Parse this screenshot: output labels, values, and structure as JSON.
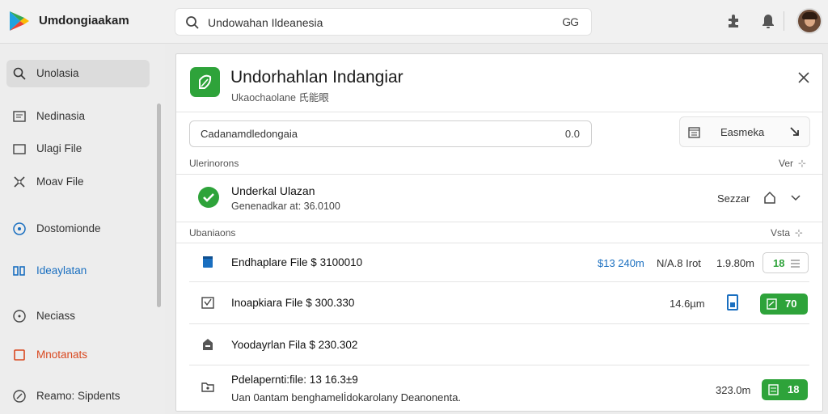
{
  "app": {
    "title": "Umdongiaakam"
  },
  "search": {
    "query": "Undowahan Ildeanesia",
    "go_label": "GG"
  },
  "sidebar": {
    "items": [
      {
        "label": "Unolasia",
        "icon": "search-icon",
        "active": true
      },
      {
        "label": "Nedinasia",
        "icon": "document-icon"
      },
      {
        "label": "Ulagi File",
        "icon": "folder-icon"
      },
      {
        "label": "Moav File",
        "icon": "tools-icon"
      },
      {
        "label": "Dostomionde",
        "icon": "info-icon"
      },
      {
        "label": "Ideaylatan",
        "icon": "columns-icon",
        "color": "#1a6fc0"
      },
      {
        "label": "Neciass",
        "icon": "clock-icon"
      },
      {
        "label": "Mnotanats",
        "icon": "bookmark-icon",
        "color": "#d9481f"
      },
      {
        "label": "Reamo: Sipdents",
        "icon": "settings-icon"
      }
    ]
  },
  "panel": {
    "title": "Undorhahlan Indangiar",
    "subtitle": "Ukaochaolane 氏能眼",
    "field": {
      "value": "Cadanamdledongaia",
      "suffix": "0.0"
    },
    "side_button": {
      "label": "Easmeka"
    },
    "section1": {
      "label": "Ulerinorons",
      "right": "Ver"
    },
    "main_item": {
      "name": "Underkal Ulazan",
      "meta": "Genenadkar at: 36.0100",
      "size": "Sezzar"
    },
    "section2": {
      "label": "Ubaniaons",
      "right": "Vsta"
    },
    "rows": [
      {
        "name": "Endhaplare File  $ 3100010",
        "col1": "$13 240m",
        "col2": "N/A.8 Irot",
        "col3": "1.9.80m",
        "badge": "18",
        "icon": "document-icon"
      },
      {
        "name": "Inoapkiara File  $ 300.330",
        "col3": "14.6µm",
        "badge": "70",
        "icon": "image-icon"
      },
      {
        "name": "Yoodayrlan Fila  $ 230.302",
        "icon": "archive-icon"
      },
      {
        "name": "Pdelapernti:file:  13 16.3±9",
        "sub": "Uan 0antam benghamelİdokarolany Deanonenta.",
        "col3": "323.0m",
        "badge": "18",
        "icon": "folder-icon"
      }
    ]
  },
  "colors": {
    "accent": "#2ea33a",
    "link": "#1a6fc0",
    "warn": "#d9481f"
  }
}
